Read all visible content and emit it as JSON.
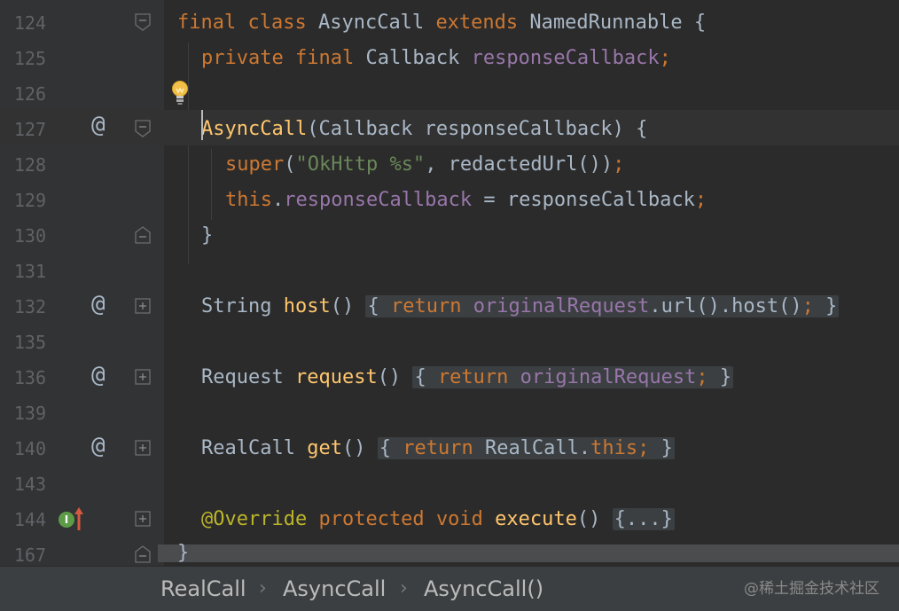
{
  "editor": {
    "lines": [
      {
        "num": "124"
      },
      {
        "num": "125"
      },
      {
        "num": "126"
      },
      {
        "num": "127"
      },
      {
        "num": "128"
      },
      {
        "num": "129"
      },
      {
        "num": "130"
      },
      {
        "num": "131"
      },
      {
        "num": "132"
      },
      {
        "num": "135"
      },
      {
        "num": "136"
      },
      {
        "num": "139"
      },
      {
        "num": "140"
      },
      {
        "num": "143"
      },
      {
        "num": "144"
      },
      {
        "num": "167"
      }
    ],
    "gutter_marks": {
      "at_symbol": "@",
      "override_badge": "I"
    },
    "code": {
      "l124": {
        "t1": "final",
        "t2": "class",
        "t3": "AsyncCall",
        "t4": "extends",
        "t5": "NamedRunnable",
        "t6": "{"
      },
      "l125": {
        "t1": "private",
        "t2": "final",
        "t3": "Callback",
        "t4": "responseCallback",
        "t5": ";"
      },
      "l127": {
        "t1": "AsyncCall",
        "t2": "(Callback responseCallback) {"
      },
      "l128": {
        "t1": "super",
        "t2": "(",
        "t3": "\"OkHttp %s\"",
        "t4": ", redactedUrl())",
        "t5": ";"
      },
      "l129": {
        "t1": "this",
        "t2": ".",
        "t3": "responseCallback",
        "t4": " = responseCallback",
        "t5": ";"
      },
      "l130": {
        "t1": "}"
      },
      "l132": {
        "t1": "String",
        "t2": "host",
        "t3": "()",
        "t4": "{",
        "t5": "return",
        "t6": "originalRequest",
        "t7": ".url().host()",
        "t8": ";",
        "t9": "}"
      },
      "l136": {
        "t1": "Request",
        "t2": "request",
        "t3": "()",
        "t4": "{",
        "t5": "return",
        "t6": "originalRequest",
        "t7": ";",
        "t8": "}"
      },
      "l140": {
        "t1": "RealCall",
        "t2": "get",
        "t3": "()",
        "t4": "{",
        "t5": "return",
        "t6": "RealCall.",
        "t7": "this",
        "t8": ";",
        "t9": "}"
      },
      "l144": {
        "t1": "@Override",
        "t2": "protected",
        "t3": "void",
        "t4": "execute",
        "t5": "()",
        "t6": "{...}"
      },
      "l167": {
        "t1": "}"
      }
    }
  },
  "breadcrumb": {
    "items": [
      "RealCall",
      "AsyncCall",
      "AsyncCall()"
    ],
    "separator": "›"
  },
  "watermark": "@稀土掘金技术社区",
  "colors": {
    "background": "#2b2b2b",
    "keyword": "#cc7832",
    "field": "#9876aa",
    "method": "#ffc66d",
    "string": "#6a8759",
    "annotation": "#bbb529",
    "text": "#a9b7c6"
  }
}
